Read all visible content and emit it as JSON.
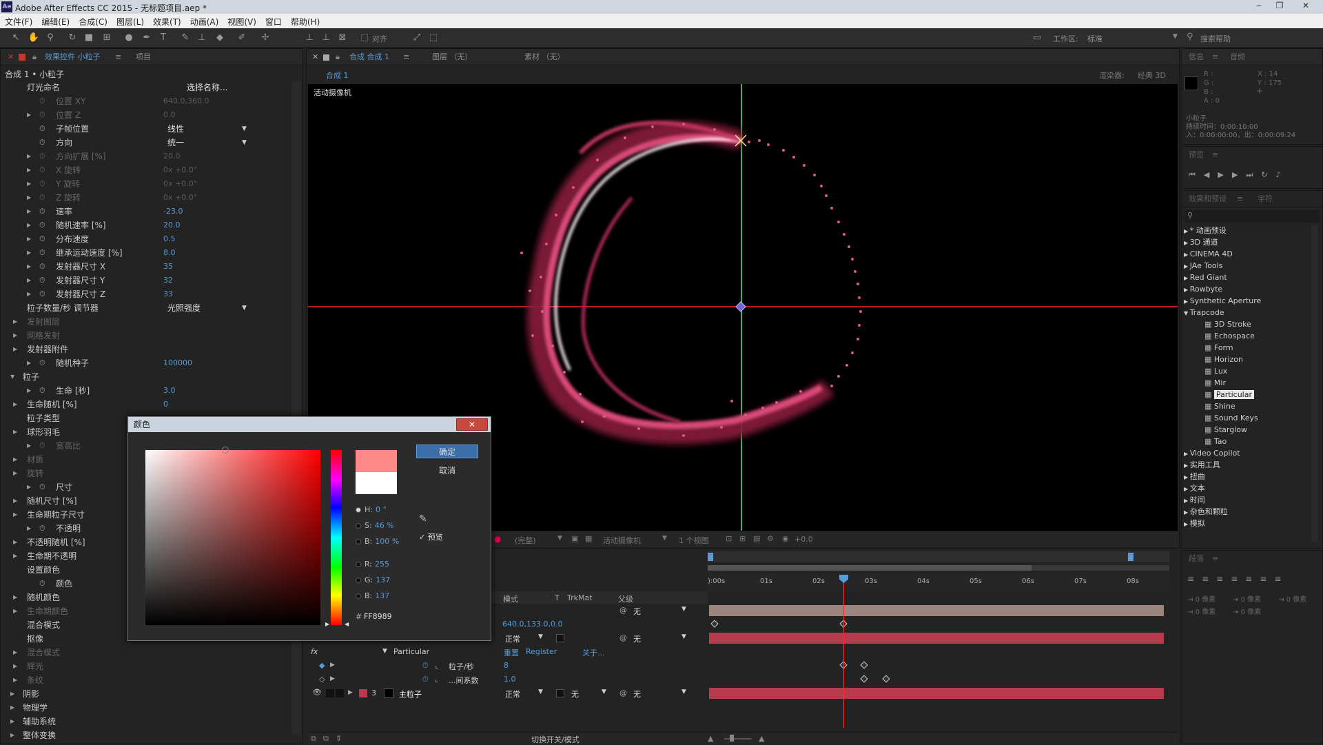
{
  "titlebar": {
    "app_icon": "Ae",
    "title": "Adobe After Effects CC 2015 - 无标题项目.aep *",
    "minimize": "‒",
    "restore": "❐",
    "close": "✕"
  },
  "menu": [
    "文件(F)",
    "编辑(E)",
    "合成(C)",
    "图层(L)",
    "效果(T)",
    "动画(A)",
    "视图(V)",
    "窗口",
    "帮助(H)"
  ],
  "toolbar": {
    "align_label": "对齐",
    "workspace_label": "工作区:",
    "workspace_value": "标准",
    "search_help": "搜索帮助"
  },
  "effects_panel": {
    "tab_active": "效果控件 小粒子",
    "tab_project": "项目",
    "subtitle": "合成 1 • 小粒子",
    "rows": [
      {
        "indent": 0,
        "tri": false,
        "stop": false,
        "label": "灯光命名",
        "value": "选择名称...",
        "vtype": "button",
        "dim": false
      },
      {
        "indent": 1,
        "tri": false,
        "stop": true,
        "label": "位置 XY",
        "value": "640.0,360.0",
        "vtype": "num",
        "dim": true
      },
      {
        "indent": 1,
        "tri": true,
        "stop": true,
        "label": "位置 Z",
        "value": "0.0",
        "vtype": "num",
        "dim": true
      },
      {
        "indent": 1,
        "tri": false,
        "stop": true,
        "label": "子帧位置",
        "value": "线性",
        "vtype": "dropdown",
        "dim": false
      },
      {
        "indent": 1,
        "tri": false,
        "stop": true,
        "label": "方向",
        "value": "统一",
        "vtype": "dropdown",
        "dim": false
      },
      {
        "indent": 1,
        "tri": true,
        "stop": true,
        "label": "方向扩展 [%]",
        "value": "20.0",
        "vtype": "num",
        "dim": true
      },
      {
        "indent": 1,
        "tri": true,
        "stop": true,
        "label": "X 旋转",
        "value": "0x +0.0°",
        "vtype": "num",
        "dim": true
      },
      {
        "indent": 1,
        "tri": true,
        "stop": true,
        "label": "Y 旋转",
        "value": "0x +0.0°",
        "vtype": "num",
        "dim": true
      },
      {
        "indent": 1,
        "tri": true,
        "stop": true,
        "label": "Z 旋转",
        "value": "0x +0.0°",
        "vtype": "num",
        "dim": true
      },
      {
        "indent": 1,
        "tri": true,
        "stop": true,
        "label": "速率",
        "value": "-23.0",
        "vtype": "num",
        "dim": false
      },
      {
        "indent": 1,
        "tri": true,
        "stop": true,
        "label": "随机速率 [%]",
        "value": "20.0",
        "vtype": "num",
        "dim": false
      },
      {
        "indent": 1,
        "tri": true,
        "stop": true,
        "label": "分布速度",
        "value": "0.5",
        "vtype": "num",
        "dim": false
      },
      {
        "indent": 1,
        "tri": true,
        "stop": true,
        "label": "继承运动速度 [%]",
        "value": "8.0",
        "vtype": "num",
        "dim": false
      },
      {
        "indent": 1,
        "tri": true,
        "stop": true,
        "label": "发射器尺寸 X",
        "value": "35",
        "vtype": "num",
        "dim": false
      },
      {
        "indent": 1,
        "tri": true,
        "stop": true,
        "label": "发射器尺寸 Y",
        "value": "32",
        "vtype": "num",
        "dim": false
      },
      {
        "indent": 1,
        "tri": true,
        "stop": true,
        "label": "发射器尺寸 Z",
        "value": "33",
        "vtype": "num",
        "dim": false
      },
      {
        "indent": 0,
        "tri": false,
        "stop": false,
        "label": "粒子数量/秒 调节器",
        "value": "光照强度",
        "vtype": "dropdown",
        "dim": false
      },
      {
        "indent": 0,
        "tri": true,
        "stop": false,
        "label": "发射图层",
        "value": "",
        "vtype": "none",
        "dim": true
      },
      {
        "indent": 0,
        "tri": true,
        "stop": false,
        "label": "网格发射",
        "value": "",
        "vtype": "none",
        "dim": true
      },
      {
        "indent": 0,
        "tri": true,
        "stop": false,
        "label": "发射器附件",
        "value": "",
        "vtype": "none",
        "dim": false
      },
      {
        "indent": 1,
        "tri": true,
        "stop": true,
        "label": "随机种子",
        "value": "100000",
        "vtype": "num",
        "dim": false
      },
      {
        "indent": -1,
        "tri": true,
        "open": true,
        "stop": false,
        "label": "粒子",
        "value": "",
        "vtype": "none",
        "dim": false
      },
      {
        "indent": 1,
        "tri": true,
        "stop": true,
        "label": "生命 [秒]",
        "value": "3.0",
        "vtype": "num",
        "dim": false
      },
      {
        "indent": 0,
        "tri": true,
        "stop": false,
        "label": "生命随机 [%]",
        "value": "0",
        "vtype": "num",
        "dim": false
      },
      {
        "indent": 0,
        "tri": false,
        "stop": false,
        "label": "粒子类型",
        "value": "",
        "vtype": "none",
        "dim": false
      },
      {
        "indent": 0,
        "tri": true,
        "stop": false,
        "label": "球形羽毛",
        "value": "",
        "vtype": "none",
        "dim": false
      },
      {
        "indent": 1,
        "tri": true,
        "stop": true,
        "label": "宽高比",
        "value": "",
        "vtype": "none",
        "dim": true
      },
      {
        "indent": 0,
        "tri": true,
        "stop": false,
        "label": "材质",
        "value": "",
        "vtype": "none",
        "dim": true
      },
      {
        "indent": 0,
        "tri": true,
        "stop": false,
        "label": "旋转",
        "value": "",
        "vtype": "none",
        "dim": true
      },
      {
        "indent": 1,
        "tri": true,
        "stop": true,
        "label": "尺寸",
        "value": "",
        "vtype": "none",
        "dim": false
      },
      {
        "indent": 0,
        "tri": true,
        "stop": false,
        "label": "随机尺寸 [%]",
        "value": "",
        "vtype": "none",
        "dim": false
      },
      {
        "indent": 0,
        "tri": true,
        "stop": false,
        "label": "生命期粒子尺寸",
        "value": "",
        "vtype": "none",
        "dim": false
      },
      {
        "indent": 1,
        "tri": true,
        "stop": true,
        "label": "不透明",
        "value": "",
        "vtype": "none",
        "dim": false
      },
      {
        "indent": 0,
        "tri": true,
        "stop": false,
        "label": "不透明随机 [%]",
        "value": "",
        "vtype": "none",
        "dim": false
      },
      {
        "indent": 0,
        "tri": true,
        "stop": false,
        "label": "生命期不透明",
        "value": "",
        "vtype": "none",
        "dim": false
      },
      {
        "indent": 0,
        "tri": false,
        "stop": false,
        "label": "设置颜色",
        "value": "",
        "vtype": "none",
        "dim": false
      },
      {
        "indent": 1,
        "tri": false,
        "stop": true,
        "label": "颜色",
        "value": "",
        "vtype": "none",
        "dim": false
      },
      {
        "indent": 0,
        "tri": true,
        "stop": false,
        "label": "随机颜色",
        "value": "",
        "vtype": "none",
        "dim": false
      },
      {
        "indent": 0,
        "tri": true,
        "stop": false,
        "label": "生命期颜色",
        "value": "",
        "vtype": "none",
        "dim": true
      },
      {
        "indent": 0,
        "tri": false,
        "stop": false,
        "label": "混合模式",
        "value": "",
        "vtype": "none",
        "dim": false
      },
      {
        "indent": 0,
        "tri": false,
        "stop": false,
        "label": "抠像",
        "value": "",
        "vtype": "none",
        "dim": false
      },
      {
        "indent": 0,
        "tri": true,
        "stop": false,
        "label": "混合模式",
        "value": "",
        "vtype": "none",
        "dim": true
      },
      {
        "indent": 0,
        "tri": true,
        "stop": false,
        "label": "辉光",
        "value": "",
        "vtype": "none",
        "dim": true
      },
      {
        "indent": 0,
        "tri": true,
        "stop": false,
        "label": "条纹",
        "value": "",
        "vtype": "none",
        "dim": true
      },
      {
        "indent": -1,
        "tri": true,
        "stop": false,
        "label": "阴影",
        "value": "",
        "vtype": "none",
        "dim": false
      },
      {
        "indent": -1,
        "tri": true,
        "stop": false,
        "label": "物理学",
        "value": "",
        "vtype": "none",
        "dim": false
      },
      {
        "indent": -1,
        "tri": true,
        "stop": false,
        "label": "辅助系统",
        "value": "",
        "vtype": "none",
        "dim": false
      },
      {
        "indent": -1,
        "tri": true,
        "stop": false,
        "label": "整体变换",
        "value": "",
        "vtype": "none",
        "dim": false
      }
    ]
  },
  "comp_panel": {
    "tab_comp": "合成 合成 1",
    "tab_layer": "图层 （无）",
    "tab_footage": "素材 （无）",
    "sub_tab": "合成 1",
    "renderer_label": "渲染器:",
    "renderer_value": "经典 3D",
    "camera_label": "活动摄像机",
    "footer": {
      "quality": "(完整)",
      "camera": "活动摄像机",
      "views": "1 个视图",
      "exposure": "+0.0"
    }
  },
  "info_panel": {
    "tab_info": "信息",
    "tab_audio": "音频",
    "rgba": [
      "R :",
      "G :",
      "B :",
      "A : 0"
    ],
    "coords": [
      "X : 14",
      "Y : 175"
    ],
    "layer_name": "小粒子",
    "duration": "持续时间：0:00:10:00",
    "in_out": "入：0:00:00:00，出：0:00:09:24"
  },
  "preview_panel": {
    "tab": "预览"
  },
  "effects_presets": {
    "tab": "效果和预设",
    "tab2": "字符",
    "search_placeholder": "",
    "tree": [
      {
        "label": "* 动画预设",
        "level": 0,
        "open": false
      },
      {
        "label": "3D 通道",
        "level": 0,
        "open": false
      },
      {
        "label": "CINEMA 4D",
        "level": 0,
        "open": false
      },
      {
        "label": "JAe Tools",
        "level": 0,
        "open": false
      },
      {
        "label": "Red Giant",
        "level": 0,
        "open": false
      },
      {
        "label": "Rowbyte",
        "level": 0,
        "open": false
      },
      {
        "label": "Synthetic Aperture",
        "level": 0,
        "open": false
      },
      {
        "label": "Trapcode",
        "level": 0,
        "open": true
      },
      {
        "label": "3D Stroke",
        "level": 1
      },
      {
        "label": "Echospace",
        "level": 1
      },
      {
        "label": "Form",
        "level": 1
      },
      {
        "label": "Horizon",
        "level": 1
      },
      {
        "label": "Lux",
        "level": 1
      },
      {
        "label": "Mir",
        "level": 1
      },
      {
        "label": "Particular",
        "level": 1,
        "selected": true
      },
      {
        "label": "Shine",
        "level": 1
      },
      {
        "label": "Sound Keys",
        "level": 1
      },
      {
        "label": "Starglow",
        "level": 1
      },
      {
        "label": "Tao",
        "level": 1
      },
      {
        "label": "Video Copilot",
        "level": 0,
        "open": false
      },
      {
        "label": "实用工具",
        "level": 0,
        "open": false
      },
      {
        "label": "扭曲",
        "level": 0,
        "open": false
      },
      {
        "label": "文本",
        "level": 0,
        "open": false
      },
      {
        "label": "时间",
        "level": 0,
        "open": false
      },
      {
        "label": "杂色和颗粒",
        "level": 0,
        "open": false
      },
      {
        "label": "模拟",
        "level": 0,
        "open": false
      }
    ]
  },
  "paragraph_panel": {
    "tab": "段落",
    "indents": [
      "0 像素",
      "0 像素",
      "0 像素",
      "0 像素",
      "0 像素"
    ]
  },
  "timeline": {
    "ruler": [
      "):00s",
      "01s",
      "02s",
      "03s",
      "04s",
      "05s",
      "06s",
      "07s",
      "08s"
    ],
    "col_mode": "模式",
    "col_t": "T",
    "col_trkmat": "TrkMat",
    "col_parent": "父级",
    "rows": [
      {
        "id": "r1",
        "mode": "",
        "trk": "",
        "parent": "无",
        "name": ""
      },
      {
        "id": "r2",
        "pos_value": "640.0,133.0,0.0"
      },
      {
        "id": "r3",
        "mode": "正常",
        "trk": "",
        "parent": "无",
        "name": ""
      },
      {
        "id": "r4",
        "fx": "fx",
        "effect": "Particular",
        "reset": "重置",
        "register": "Register",
        "about": "关于..."
      },
      {
        "id": "r5",
        "prop": "粒子/秒",
        "value": "8"
      },
      {
        "id": "r6",
        "prop": "...间系数",
        "value": "1.0"
      },
      {
        "id": "r7",
        "num": "3",
        "name": "主粒子",
        "mode": "正常",
        "trk": "无",
        "parent": "无"
      }
    ],
    "footer": "切换开关/模式"
  },
  "color_dialog": {
    "title": "颜色",
    "close": "✕",
    "ok": "确定",
    "cancel": "取消",
    "preview_label": "预览",
    "fields": [
      {
        "label": "H:",
        "value": "0 °"
      },
      {
        "label": "S:",
        "value": "46 %"
      },
      {
        "label": "B:",
        "value": "100 %"
      },
      {
        "label": "R:",
        "value": "255"
      },
      {
        "label": "G:",
        "value": "137"
      },
      {
        "label": "B:",
        "value": "137"
      }
    ],
    "hex_label": "#",
    "hex_value": "FF8989",
    "new_color": "#FF8989",
    "old_color": "#FFFFFF"
  },
  "colors": {
    "accent_blue": "#5b9bd5",
    "layer_red": "#b73a4d",
    "selection": "#3b6ea8"
  }
}
